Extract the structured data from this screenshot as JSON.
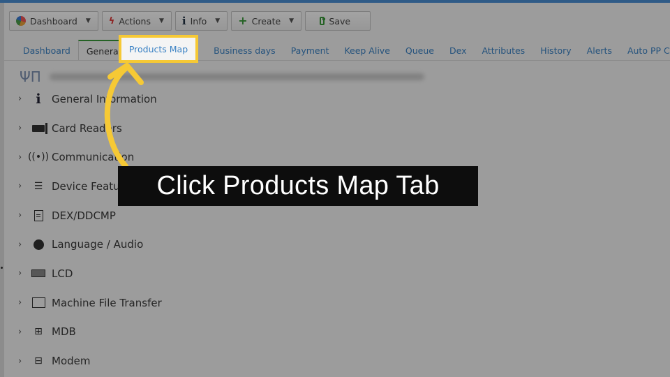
{
  "toolbar": {
    "buttons": [
      {
        "label": "Dashboard",
        "icon": "pie-chart-icon"
      },
      {
        "label": "Actions",
        "icon": "lightning-icon"
      },
      {
        "label": "Info",
        "icon": "info-icon"
      },
      {
        "label": "Create",
        "icon": "plus-icon"
      },
      {
        "label": "Save",
        "icon": "save-icon"
      }
    ]
  },
  "tabs": {
    "items": [
      "Dashboard",
      "General",
      "Products Map",
      "Business days",
      "Payment",
      "Keep Alive",
      "Queue",
      "Dex",
      "Attributes",
      "History",
      "Alerts",
      "Auto PP Cards"
    ],
    "active": "General",
    "highlighted": "Products Map"
  },
  "content": {
    "header_icon": "fork-spoon-icon"
  },
  "tree": {
    "items": [
      {
        "label": "General Information",
        "icon": "info-icon"
      },
      {
        "label": "Card Readers",
        "icon": "card-reader-icon"
      },
      {
        "label": "Communication",
        "icon": "antenna-icon"
      },
      {
        "label": "Device Features",
        "icon": "list-icon"
      },
      {
        "label": "DEX/DDCMP",
        "icon": "document-icon"
      },
      {
        "label": "Language / Audio",
        "icon": "globe-icon"
      },
      {
        "label": "LCD",
        "icon": "lcd-icon"
      },
      {
        "label": "Machine File Transfer",
        "icon": "ftp-icon"
      },
      {
        "label": "MDB",
        "icon": "mdb-icon"
      },
      {
        "label": "Modem",
        "icon": "modem-icon"
      }
    ]
  },
  "callout": {
    "text": "Click Products Map Tab"
  },
  "colors": {
    "highlight": "#f6c935",
    "link": "#3b82c4",
    "callout_bg": "#0d0d0d"
  }
}
